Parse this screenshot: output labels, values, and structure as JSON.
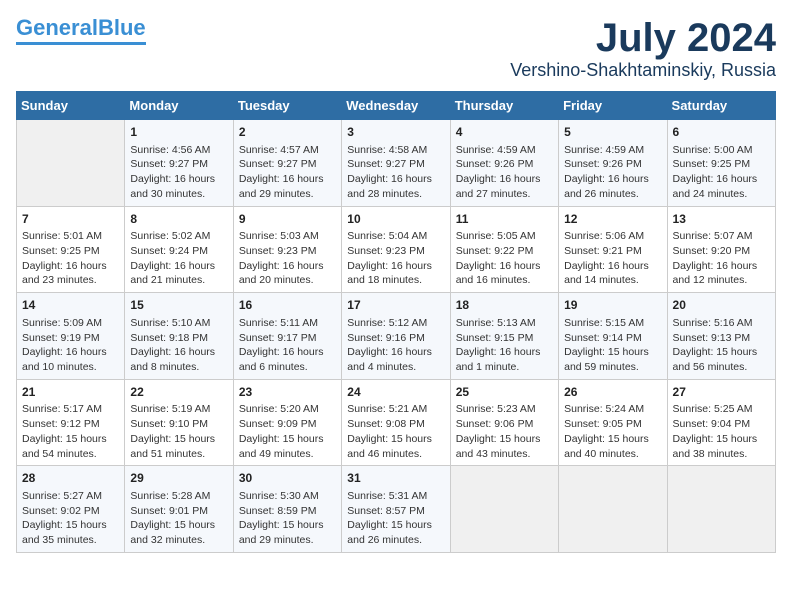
{
  "header": {
    "logo_line1": "General",
    "logo_line2": "Blue",
    "title": "July 2024",
    "subtitle": "Vershino-Shakhtaminskiy, Russia"
  },
  "days_of_week": [
    "Sunday",
    "Monday",
    "Tuesday",
    "Wednesday",
    "Thursday",
    "Friday",
    "Saturday"
  ],
  "weeks": [
    [
      {
        "day": "",
        "content": ""
      },
      {
        "day": "1",
        "content": "Sunrise: 4:56 AM\nSunset: 9:27 PM\nDaylight: 16 hours\nand 30 minutes."
      },
      {
        "day": "2",
        "content": "Sunrise: 4:57 AM\nSunset: 9:27 PM\nDaylight: 16 hours\nand 29 minutes."
      },
      {
        "day": "3",
        "content": "Sunrise: 4:58 AM\nSunset: 9:27 PM\nDaylight: 16 hours\nand 28 minutes."
      },
      {
        "day": "4",
        "content": "Sunrise: 4:59 AM\nSunset: 9:26 PM\nDaylight: 16 hours\nand 27 minutes."
      },
      {
        "day": "5",
        "content": "Sunrise: 4:59 AM\nSunset: 9:26 PM\nDaylight: 16 hours\nand 26 minutes."
      },
      {
        "day": "6",
        "content": "Sunrise: 5:00 AM\nSunset: 9:25 PM\nDaylight: 16 hours\nand 24 minutes."
      }
    ],
    [
      {
        "day": "7",
        "content": "Sunrise: 5:01 AM\nSunset: 9:25 PM\nDaylight: 16 hours\nand 23 minutes."
      },
      {
        "day": "8",
        "content": "Sunrise: 5:02 AM\nSunset: 9:24 PM\nDaylight: 16 hours\nand 21 minutes."
      },
      {
        "day": "9",
        "content": "Sunrise: 5:03 AM\nSunset: 9:23 PM\nDaylight: 16 hours\nand 20 minutes."
      },
      {
        "day": "10",
        "content": "Sunrise: 5:04 AM\nSunset: 9:23 PM\nDaylight: 16 hours\nand 18 minutes."
      },
      {
        "day": "11",
        "content": "Sunrise: 5:05 AM\nSunset: 9:22 PM\nDaylight: 16 hours\nand 16 minutes."
      },
      {
        "day": "12",
        "content": "Sunrise: 5:06 AM\nSunset: 9:21 PM\nDaylight: 16 hours\nand 14 minutes."
      },
      {
        "day": "13",
        "content": "Sunrise: 5:07 AM\nSunset: 9:20 PM\nDaylight: 16 hours\nand 12 minutes."
      }
    ],
    [
      {
        "day": "14",
        "content": "Sunrise: 5:09 AM\nSunset: 9:19 PM\nDaylight: 16 hours\nand 10 minutes."
      },
      {
        "day": "15",
        "content": "Sunrise: 5:10 AM\nSunset: 9:18 PM\nDaylight: 16 hours\nand 8 minutes."
      },
      {
        "day": "16",
        "content": "Sunrise: 5:11 AM\nSunset: 9:17 PM\nDaylight: 16 hours\nand 6 minutes."
      },
      {
        "day": "17",
        "content": "Sunrise: 5:12 AM\nSunset: 9:16 PM\nDaylight: 16 hours\nand 4 minutes."
      },
      {
        "day": "18",
        "content": "Sunrise: 5:13 AM\nSunset: 9:15 PM\nDaylight: 16 hours\nand 1 minute."
      },
      {
        "day": "19",
        "content": "Sunrise: 5:15 AM\nSunset: 9:14 PM\nDaylight: 15 hours\nand 59 minutes."
      },
      {
        "day": "20",
        "content": "Sunrise: 5:16 AM\nSunset: 9:13 PM\nDaylight: 15 hours\nand 56 minutes."
      }
    ],
    [
      {
        "day": "21",
        "content": "Sunrise: 5:17 AM\nSunset: 9:12 PM\nDaylight: 15 hours\nand 54 minutes."
      },
      {
        "day": "22",
        "content": "Sunrise: 5:19 AM\nSunset: 9:10 PM\nDaylight: 15 hours\nand 51 minutes."
      },
      {
        "day": "23",
        "content": "Sunrise: 5:20 AM\nSunset: 9:09 PM\nDaylight: 15 hours\nand 49 minutes."
      },
      {
        "day": "24",
        "content": "Sunrise: 5:21 AM\nSunset: 9:08 PM\nDaylight: 15 hours\nand 46 minutes."
      },
      {
        "day": "25",
        "content": "Sunrise: 5:23 AM\nSunset: 9:06 PM\nDaylight: 15 hours\nand 43 minutes."
      },
      {
        "day": "26",
        "content": "Sunrise: 5:24 AM\nSunset: 9:05 PM\nDaylight: 15 hours\nand 40 minutes."
      },
      {
        "day": "27",
        "content": "Sunrise: 5:25 AM\nSunset: 9:04 PM\nDaylight: 15 hours\nand 38 minutes."
      }
    ],
    [
      {
        "day": "28",
        "content": "Sunrise: 5:27 AM\nSunset: 9:02 PM\nDaylight: 15 hours\nand 35 minutes."
      },
      {
        "day": "29",
        "content": "Sunrise: 5:28 AM\nSunset: 9:01 PM\nDaylight: 15 hours\nand 32 minutes."
      },
      {
        "day": "30",
        "content": "Sunrise: 5:30 AM\nSunset: 8:59 PM\nDaylight: 15 hours\nand 29 minutes."
      },
      {
        "day": "31",
        "content": "Sunrise: 5:31 AM\nSunset: 8:57 PM\nDaylight: 15 hours\nand 26 minutes."
      },
      {
        "day": "",
        "content": ""
      },
      {
        "day": "",
        "content": ""
      },
      {
        "day": "",
        "content": ""
      }
    ]
  ]
}
